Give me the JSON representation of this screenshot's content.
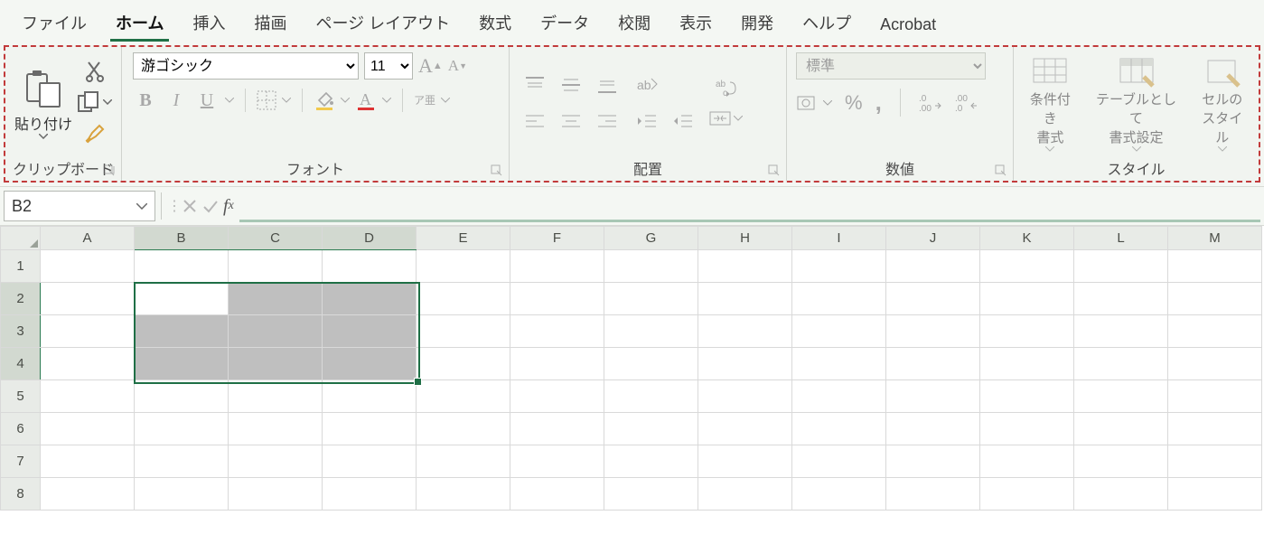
{
  "tabs": {
    "file": "ファイル",
    "home": "ホーム",
    "insert": "挿入",
    "draw": "描画",
    "layout": "ページ レイアウト",
    "formulas": "数式",
    "data": "データ",
    "review": "校閲",
    "view": "表示",
    "dev": "開発",
    "help": "ヘルプ",
    "acrobat": "Acrobat",
    "active": "home"
  },
  "ribbon": {
    "clipboard": {
      "label": "クリップボード",
      "paste": "貼り付け"
    },
    "font": {
      "label": "フォント",
      "name": "游ゴシック",
      "size": "11",
      "ruby": "ア亜"
    },
    "align": {
      "label": "配置"
    },
    "number": {
      "label": "数値",
      "format": "標準"
    },
    "styles": {
      "label": "スタイル",
      "cond": "条件付き書式",
      "table": "テーブルとして書式設定",
      "cell": "セルのスタイル"
    }
  },
  "formula": {
    "namebox": "B2",
    "value": ""
  },
  "grid": {
    "columns": [
      "A",
      "B",
      "C",
      "D",
      "E",
      "F",
      "G",
      "H",
      "I",
      "J",
      "K",
      "L",
      "M"
    ],
    "rows": [
      "1",
      "2",
      "3",
      "4",
      "5",
      "6",
      "7",
      "8"
    ],
    "selection": {
      "active": "B2",
      "range": "B2:D4",
      "col_start": "B",
      "col_end": "D",
      "row_start": 2,
      "row_end": 4
    }
  }
}
